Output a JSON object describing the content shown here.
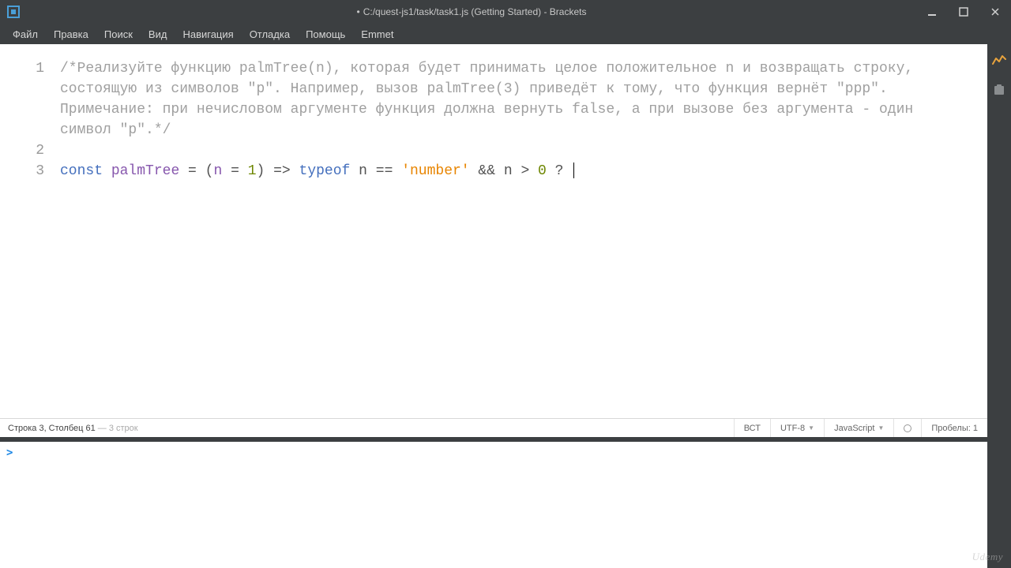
{
  "titlebar": {
    "dirty_indicator": "•",
    "title": "C:/quest-js1/task/task1.js (Getting Started) - Brackets"
  },
  "menu": {
    "items": [
      "Файл",
      "Правка",
      "Поиск",
      "Вид",
      "Навигация",
      "Отладка",
      "Помощь",
      "Emmet"
    ]
  },
  "gutter": {
    "l1": "1",
    "l2": "2",
    "l3": "3"
  },
  "code": {
    "comment": "/*Реализуйте функцию palmTree(n), которая будет принимать целое положительное n и возвращать строку, состоящую из символов \"p\". Например, вызов palmTree(3) приведёт к тому, что функция вернёт \"ppp\". Примечание: при нечисловом аргументе функция должна вернуть false, а при вызове без аргумента - один символ \"p\".*/",
    "kw_const": "const",
    "ident_palmTree": "palmTree",
    "eq1": " = ",
    "lp1": "(",
    "ident_n1": "n",
    "eq2": " = ",
    "num_1": "1",
    "rp1": ")",
    "arrow": " => ",
    "kw_typeof": "typeof",
    "sp1": " ",
    "ident_n2": "n",
    "eqeq": " == ",
    "str_number": "'number'",
    "andand": " && ",
    "ident_n3": "n",
    "gt": " > ",
    "num_0": "0",
    "qmark": " ? "
  },
  "status": {
    "left_main": "Строка 3, Столбец 61",
    "left_dim": " — 3 строк",
    "ins": "ВСТ",
    "enc": "UTF-8",
    "lang": "JavaScript",
    "spaces": "Пробелы: 1"
  },
  "console": {
    "prompt": ">"
  },
  "watermark": "Udemy"
}
